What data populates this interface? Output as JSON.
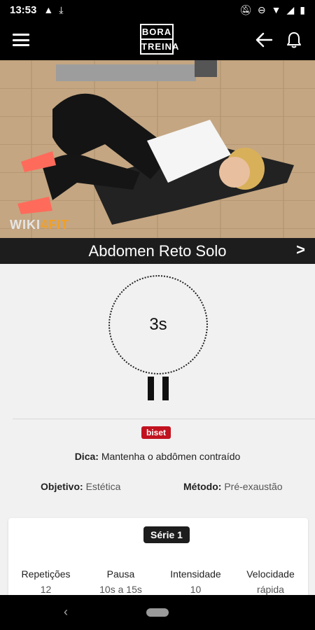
{
  "status_bar": {
    "time": "13:53"
  },
  "app": {
    "logo_line1": "BORA",
    "logo_line2": "TREINA"
  },
  "video": {
    "watermark_a": "WIKI",
    "watermark_b": "4FIT"
  },
  "exercise": {
    "title": "Abdomen Reto Solo",
    "next_label": ">"
  },
  "timer": {
    "value": "3s"
  },
  "badge": "biset",
  "tip": {
    "label": "Dica:",
    "text": "Mantenha o abdômen contraído"
  },
  "goal": {
    "label": "Objetivo:",
    "value": "Estética"
  },
  "method": {
    "label": "Método:",
    "value": "Pré-exaustão"
  },
  "series": {
    "label": "Série 1",
    "stats": [
      {
        "header": "Repetições",
        "value": "12"
      },
      {
        "header": "Pausa",
        "value": "10s a 15s"
      },
      {
        "header": "Intensidade",
        "value": "10"
      },
      {
        "header": "Velocidade",
        "value": "rápida"
      }
    ]
  },
  "colors": {
    "accent": "#c1121f",
    "bar": "#000000",
    "dark": "#1d1d1d"
  }
}
